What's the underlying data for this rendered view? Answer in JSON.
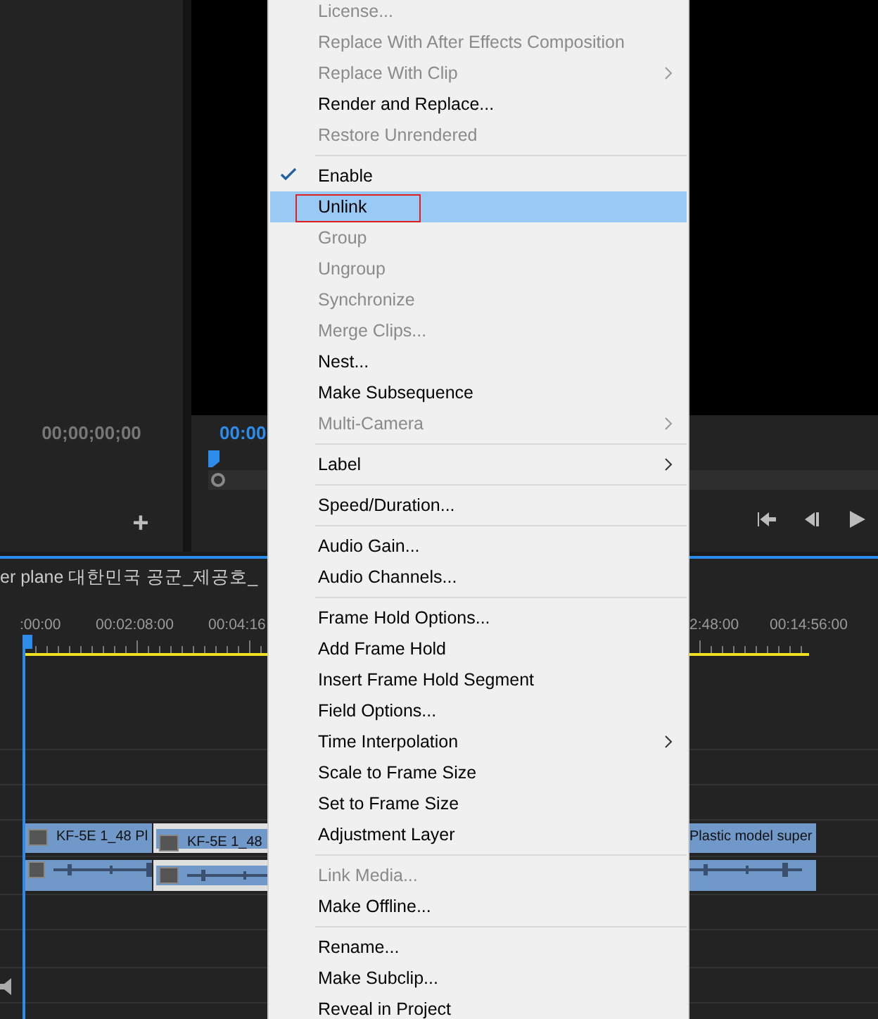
{
  "source_monitor": {
    "timecode": "00;00;00;00",
    "add_button": "+"
  },
  "program_monitor": {
    "timecode": "00:00"
  },
  "sequence_tab": {
    "title": "er plane 대한민국 공군_제공호_"
  },
  "timeline": {
    "ruler": [
      ":00:00",
      "00:02:08:00",
      "00:04:16",
      "2:48:00",
      "00:14:56:00"
    ],
    "tracks": [
      {
        "kind": "video",
        "clips": [
          {
            "label": "KF-5E 1_48 Pl",
            "selected": false
          },
          {
            "label": "KF-5E 1_48",
            "selected": true
          },
          {
            "label": "Plastic model  super",
            "selected": false
          }
        ]
      },
      {
        "kind": "audio",
        "clips": [
          {
            "selected": false
          },
          {
            "selected": true
          },
          {
            "selected": false
          }
        ]
      }
    ]
  },
  "context_menu": {
    "items": [
      {
        "kind": "item",
        "label": "License...",
        "disabled": true,
        "submenu": false,
        "checked": false,
        "selected": false
      },
      {
        "kind": "item",
        "label": "Replace With After Effects Composition",
        "disabled": true,
        "submenu": false,
        "checked": false,
        "selected": false
      },
      {
        "kind": "item",
        "label": "Replace With Clip",
        "disabled": true,
        "submenu": true,
        "checked": false,
        "selected": false
      },
      {
        "kind": "item",
        "label": "Render and Replace...",
        "disabled": false,
        "submenu": false,
        "checked": false,
        "selected": false
      },
      {
        "kind": "item",
        "label": "Restore Unrendered",
        "disabled": true,
        "submenu": false,
        "checked": false,
        "selected": false
      },
      {
        "kind": "separator"
      },
      {
        "kind": "item",
        "label": "Enable",
        "disabled": false,
        "submenu": false,
        "checked": true,
        "selected": false
      },
      {
        "kind": "item",
        "label": "Unlink",
        "disabled": false,
        "submenu": false,
        "checked": false,
        "selected": true,
        "outlined": true
      },
      {
        "kind": "item",
        "label": "Group",
        "disabled": true,
        "submenu": false,
        "checked": false,
        "selected": false
      },
      {
        "kind": "item",
        "label": "Ungroup",
        "disabled": true,
        "submenu": false,
        "checked": false,
        "selected": false
      },
      {
        "kind": "item",
        "label": "Synchronize",
        "disabled": true,
        "submenu": false,
        "checked": false,
        "selected": false
      },
      {
        "kind": "item",
        "label": "Merge Clips...",
        "disabled": true,
        "submenu": false,
        "checked": false,
        "selected": false
      },
      {
        "kind": "item",
        "label": "Nest...",
        "disabled": false,
        "submenu": false,
        "checked": false,
        "selected": false
      },
      {
        "kind": "item",
        "label": "Make Subsequence",
        "disabled": false,
        "submenu": false,
        "checked": false,
        "selected": false
      },
      {
        "kind": "item",
        "label": "Multi-Camera",
        "disabled": true,
        "submenu": true,
        "checked": false,
        "selected": false
      },
      {
        "kind": "separator"
      },
      {
        "kind": "item",
        "label": "Label",
        "disabled": false,
        "submenu": true,
        "checked": false,
        "selected": false
      },
      {
        "kind": "separator"
      },
      {
        "kind": "item",
        "label": "Speed/Duration...",
        "disabled": false,
        "submenu": false,
        "checked": false,
        "selected": false
      },
      {
        "kind": "separator"
      },
      {
        "kind": "item",
        "label": "Audio Gain...",
        "disabled": false,
        "submenu": false,
        "checked": false,
        "selected": false
      },
      {
        "kind": "item",
        "label": "Audio Channels...",
        "disabled": false,
        "submenu": false,
        "checked": false,
        "selected": false
      },
      {
        "kind": "separator"
      },
      {
        "kind": "item",
        "label": "Frame Hold Options...",
        "disabled": false,
        "submenu": false,
        "checked": false,
        "selected": false
      },
      {
        "kind": "item",
        "label": "Add Frame Hold",
        "disabled": false,
        "submenu": false,
        "checked": false,
        "selected": false
      },
      {
        "kind": "item",
        "label": "Insert Frame Hold Segment",
        "disabled": false,
        "submenu": false,
        "checked": false,
        "selected": false
      },
      {
        "kind": "item",
        "label": "Field Options...",
        "disabled": false,
        "submenu": false,
        "checked": false,
        "selected": false
      },
      {
        "kind": "item",
        "label": "Time Interpolation",
        "disabled": false,
        "submenu": true,
        "checked": false,
        "selected": false
      },
      {
        "kind": "item",
        "label": "Scale to Frame Size",
        "disabled": false,
        "submenu": false,
        "checked": false,
        "selected": false
      },
      {
        "kind": "item",
        "label": "Set to Frame Size",
        "disabled": false,
        "submenu": false,
        "checked": false,
        "selected": false
      },
      {
        "kind": "item",
        "label": "Adjustment Layer",
        "disabled": false,
        "submenu": false,
        "checked": false,
        "selected": false
      },
      {
        "kind": "separator"
      },
      {
        "kind": "item",
        "label": "Link Media...",
        "disabled": true,
        "submenu": false,
        "checked": false,
        "selected": false
      },
      {
        "kind": "item",
        "label": "Make Offline...",
        "disabled": false,
        "submenu": false,
        "checked": false,
        "selected": false
      },
      {
        "kind": "separator"
      },
      {
        "kind": "item",
        "label": "Rename...",
        "disabled": false,
        "submenu": false,
        "checked": false,
        "selected": false
      },
      {
        "kind": "item",
        "label": "Make Subclip...",
        "disabled": false,
        "submenu": false,
        "checked": false,
        "selected": false
      },
      {
        "kind": "item",
        "label": "Reveal in Project",
        "disabled": false,
        "submenu": false,
        "checked": false,
        "selected": false
      }
    ]
  }
}
